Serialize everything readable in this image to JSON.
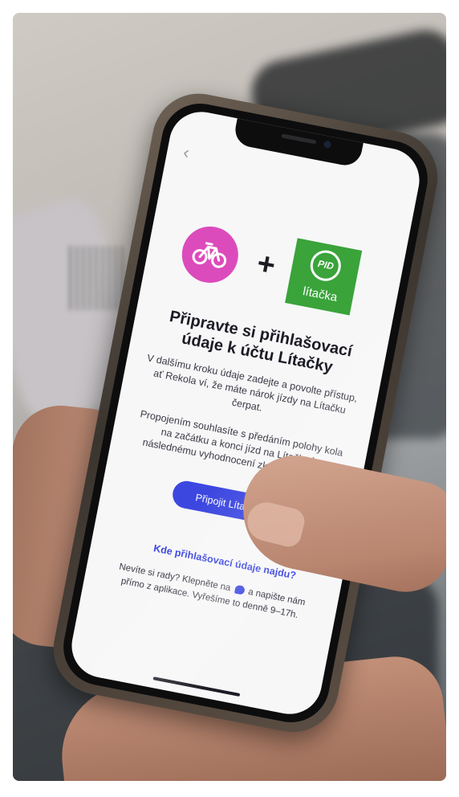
{
  "screen": {
    "back_icon": "chevron-left-icon",
    "logos": {
      "left": "rekola-bike-logo",
      "plus": "+",
      "right_word": "lítačka",
      "right_mark": "PID"
    },
    "headline": "Připravte si přihlašovací údaje k účtu Lítačky",
    "paragraph_1": "V dalšímu kroku údaje zadejte a povolte přístup, ať Rekola ví, že máte nárok jízdy na Lítačku čerpat.",
    "paragraph_2": "Propojením souhlasíte s předáním polohy kola na začátku a konci jízd na Lítačku k následnému vyhodnocení zkušebního prov",
    "connect_button": "Připojit Lítačku",
    "help_link": "Kde přihlašovací údaje najdu?",
    "support_before": "Nevíte si rady? Klepněte na",
    "support_after": "a napište nám přímo z aplikace. Vyřešíme to denně 9–17h."
  },
  "colors": {
    "accent": "#3c47e0",
    "rekola_pink": "#dc4bbb",
    "pid_green": "#3aa33a"
  }
}
